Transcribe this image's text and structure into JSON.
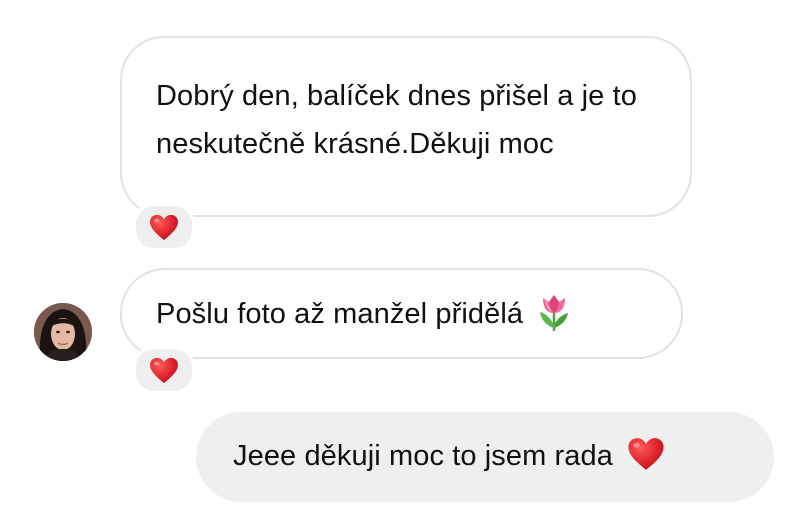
{
  "conversation": {
    "messages": [
      {
        "direction": "incoming",
        "text": "Dobrý den, balíček dnes přišel a je to neskutečně krásné.Děkuji moc",
        "reaction": "heart-icon"
      },
      {
        "direction": "incoming",
        "text": "Pošlu foto až manžel přidělá",
        "emoji": "tulip-icon",
        "reaction": "heart-icon",
        "has_avatar": true
      },
      {
        "direction": "outgoing",
        "text": "Jeee děkuji moc to jsem rada",
        "emoji": "heart-icon"
      }
    ]
  },
  "colors": {
    "outgoing_bubble": "#efefef",
    "incoming_border": "#e2e2e2",
    "heart": "#e0262e",
    "text": "#111111"
  }
}
